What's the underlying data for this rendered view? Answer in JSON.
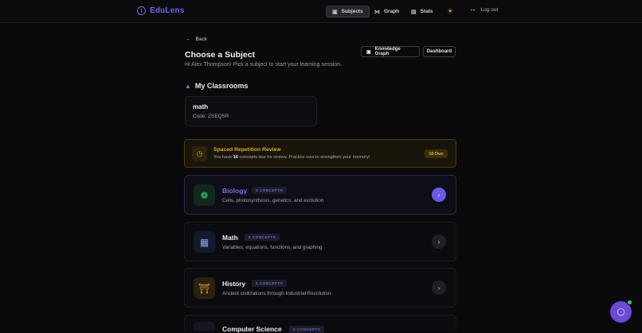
{
  "app": {
    "name": "EduLens"
  },
  "nav": {
    "items": [
      {
        "label": "Subjects",
        "icon": "book-icon",
        "active": true
      },
      {
        "label": "Graph",
        "icon": "network-icon",
        "active": false
      },
      {
        "label": "Stats",
        "icon": "bar-chart-icon",
        "active": false
      }
    ],
    "theme_icon": "sun-icon",
    "logout_label": "Log out"
  },
  "page": {
    "back_label": "Back",
    "title": "Choose a Subject",
    "subtitle": "Hi Alex Thompson! Pick a subject to start your learning session.",
    "knowledge_graph_label": "Knowledge Graph",
    "dashboard_label": "Dashboard"
  },
  "classrooms": {
    "heading": "My Classrooms",
    "items": [
      {
        "name": "math",
        "code": "Code: ZSEQ5R"
      }
    ]
  },
  "review": {
    "title": "Spaced Repetition Review",
    "text_before": "You have ",
    "count": "16",
    "text_after": " concepts due for review. Practice now to strengthen your memory!",
    "badge": "16 Due"
  },
  "subjects": [
    {
      "name": "Biology",
      "badge": "5 CONCEPTS",
      "desc": "Cells, photosynthesis, genetics, and evolution",
      "icon": "dna-icon",
      "accent": "#6a5ae8"
    },
    {
      "name": "Math",
      "badge": "5 CONCEPTS",
      "desc": "Variables, equations, functions, and graphing",
      "icon": "calculator-icon",
      "accent": "#f0f0f4"
    },
    {
      "name": "History",
      "badge": "5 CONCEPTS",
      "desc": "Ancient civilizations through Industrial Revolution",
      "icon": "landmark-icon",
      "accent": "#f0f0f4"
    },
    {
      "name": "Computer Science",
      "badge": "5 CONCEPTS",
      "desc": "",
      "icon": "code-icon",
      "accent": "#f0f0f4"
    }
  ],
  "colors": {
    "accent": "#6a5ae8",
    "warning": "#e0a82a",
    "success": "#3acb72"
  }
}
